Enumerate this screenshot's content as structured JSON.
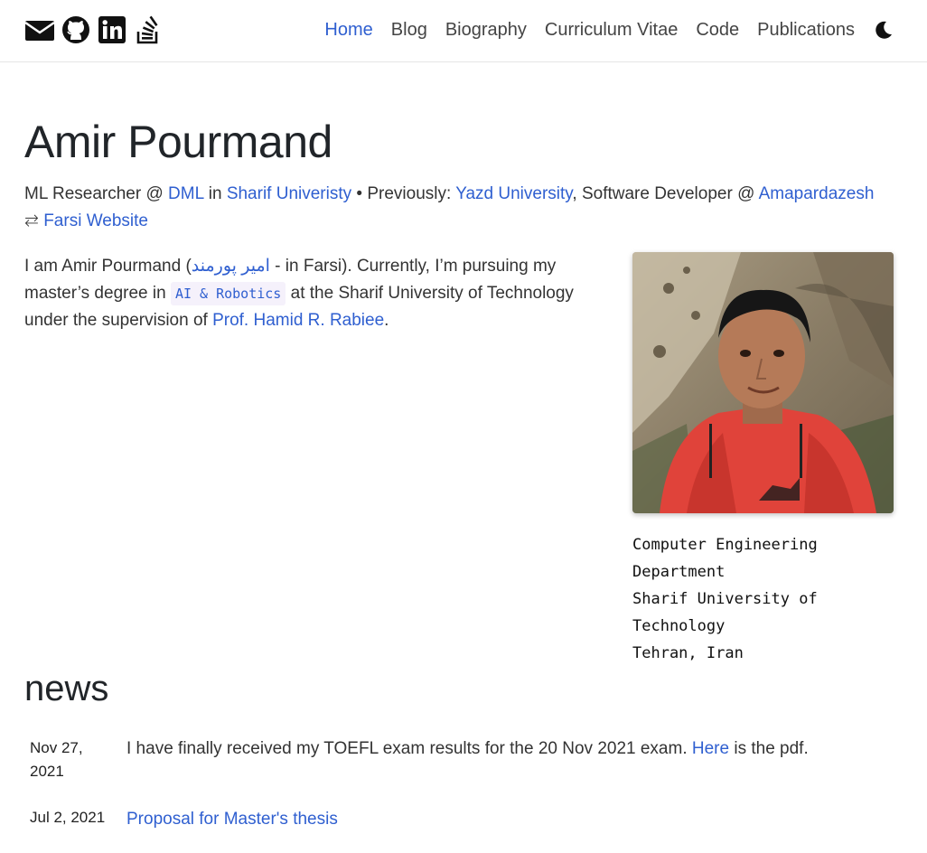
{
  "nav": {
    "social": [
      {
        "icon": "envelope-icon",
        "name": "email"
      },
      {
        "icon": "github-icon",
        "name": "github"
      },
      {
        "icon": "linkedin-icon",
        "name": "linkedin"
      },
      {
        "icon": "stackoverflow-icon",
        "name": "stackoverflow"
      }
    ],
    "links": [
      {
        "label": "Home",
        "active": true
      },
      {
        "label": "Blog"
      },
      {
        "label": "Biography"
      },
      {
        "label": "Curriculum Vitae"
      },
      {
        "label": "Code"
      },
      {
        "label": "Publications"
      }
    ],
    "theme_toggle_icon": "moon-icon"
  },
  "header": {
    "title": "Amir Pourmand",
    "subtitle": {
      "role_prefix": "ML Researcher @ ",
      "lab": "DML",
      "in": " in ",
      "university": "Sharif Univeristy",
      "previously": " • Previously: ",
      "prev_university": "Yazd University",
      "sep": ", Software Developer @ ",
      "company": "Amapardazesh",
      "swap_icon": "⇄",
      "farsi_site": "Farsi Website"
    }
  },
  "about": {
    "p1": "I am Amir Pourmand (",
    "farsi_name": "امیر پورمند",
    "p2": " - in Farsi). Currently, I’m pursuing my master’s degree in ",
    "program": "AI & Robotics",
    "p3": " at the Sharif University of Technology under the supervision of ",
    "supervisor": "Prof. Hamid R. Rabiee",
    "p4": ".",
    "address_lines": [
      "Computer Engineering",
      "Department",
      "Sharif University of",
      "Technology",
      "Tehran, Iran"
    ]
  },
  "news": {
    "heading": "news",
    "items": [
      {
        "date_line1": "Nov 27,",
        "date_line2": "2021",
        "text": "I have finally received my TOEFL exam results for the 20 Nov 2021 exam. ",
        "link": "Here",
        "text_after": " is the pdf."
      },
      {
        "date_line1": "Jul 2, 2021",
        "link": "Proposal for Master's thesis"
      }
    ]
  },
  "colors": {
    "link": "#2f5fd0",
    "text": "#212529",
    "code_bg": "#f5f1fb"
  }
}
